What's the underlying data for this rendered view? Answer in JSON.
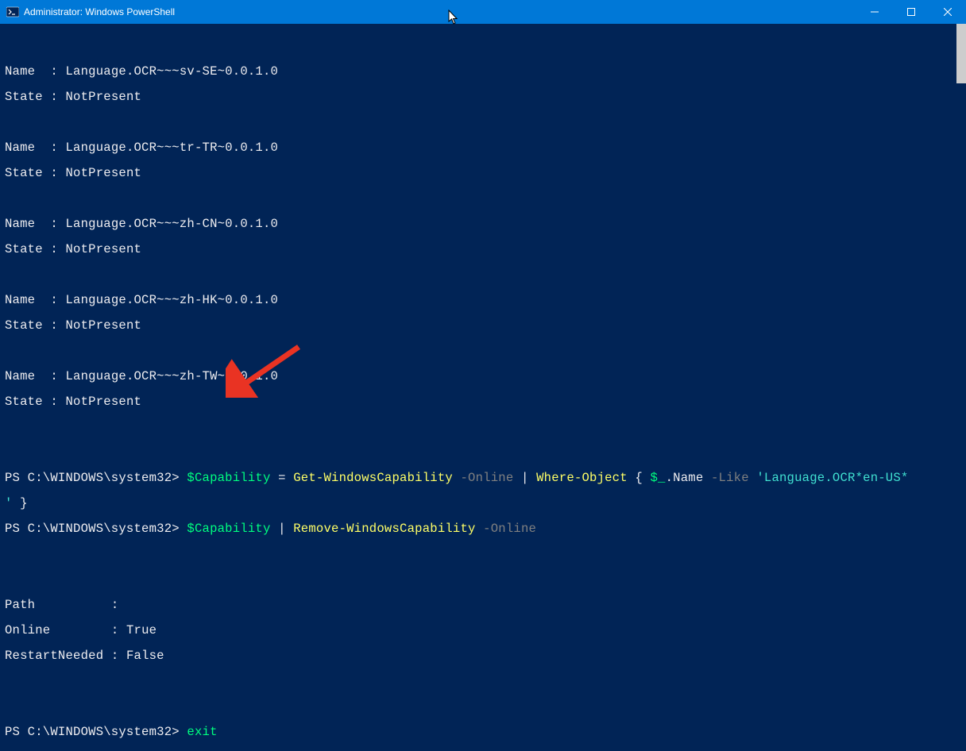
{
  "window": {
    "title": "Administrator: Windows PowerShell"
  },
  "colors": {
    "titlebar": "#0078d7",
    "terminal_bg": "#012456",
    "text": "#eeedf0",
    "green": "#00ff7f",
    "cyan": "#40e0d0",
    "gray": "#808080",
    "purple": "#cc99ff",
    "yellow": "#ffff66",
    "arrow": "#e93323"
  },
  "capabilities": [
    {
      "name_label": "Name ",
      "name_sep": " : ",
      "name_value": "Language.OCR~~~sv-SE~0.0.1.0",
      "state_label": "State",
      "state_sep": " : ",
      "state_value": "NotPresent"
    },
    {
      "name_label": "Name ",
      "name_sep": " : ",
      "name_value": "Language.OCR~~~tr-TR~0.0.1.0",
      "state_label": "State",
      "state_sep": " : ",
      "state_value": "NotPresent"
    },
    {
      "name_label": "Name ",
      "name_sep": " : ",
      "name_value": "Language.OCR~~~zh-CN~0.0.1.0",
      "state_label": "State",
      "state_sep": " : ",
      "state_value": "NotPresent"
    },
    {
      "name_label": "Name ",
      "name_sep": " : ",
      "name_value": "Language.OCR~~~zh-HK~0.0.1.0",
      "state_label": "State",
      "state_sep": " : ",
      "state_value": "NotPresent"
    },
    {
      "name_label": "Name ",
      "name_sep": " : ",
      "name_value": "Language.OCR~~~zh-TW~0.0.1.0",
      "state_label": "State",
      "state_sep": " : ",
      "state_value": "NotPresent"
    }
  ],
  "prompt1": {
    "ps": "PS C:\\WINDOWS\\system32> ",
    "var": "$Capability",
    "eq": " = ",
    "cmd": "Get-WindowsCapability",
    "sp1": " ",
    "param": "-Online",
    "sp2": " ",
    "pipe": "|",
    "sp3": " ",
    "where": "Where-Object",
    "sp4": " ",
    "brace_open": "{",
    "sp5": " ",
    "auto": "$_",
    "dot": ".Name ",
    "like": "-Like",
    "sp6": " ",
    "str": "'Language.OCR*en-US*",
    "cont": "'",
    "sp7": " ",
    "brace_close": "}"
  },
  "prompt2": {
    "ps": "PS C:\\WINDOWS\\system32> ",
    "var": "$Capability",
    "sp1": " ",
    "pipe": "|",
    "sp2": " ",
    "cmd": "Remove-WindowsCapability",
    "sp3": " ",
    "param": "-Online"
  },
  "result": {
    "path_label": "Path         ",
    "path_sep": " : ",
    "path_value": "",
    "online_label": "Online       ",
    "online_sep": " : ",
    "online_value": "True",
    "restart_label": "RestartNeeded",
    "restart_sep": " : ",
    "restart_value": "False"
  },
  "prompt3": {
    "ps": "PS C:\\WINDOWS\\system32> ",
    "cmd": "exit"
  }
}
